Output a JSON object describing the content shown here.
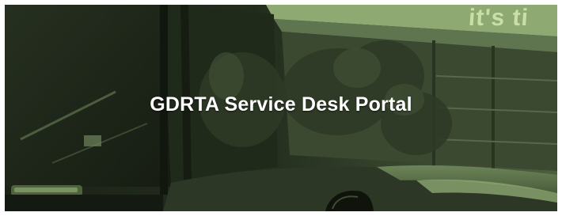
{
  "banner": {
    "title": "GDRTA Service Desk Portal",
    "slogan_fragment": "it's ti",
    "image_description_icon": "bus-photo"
  },
  "colors": {
    "tint_dark": "#1a2116",
    "tint_mid": "#3b4a30",
    "tint_light": "#a9c28a",
    "title_text": "#ffffff"
  }
}
